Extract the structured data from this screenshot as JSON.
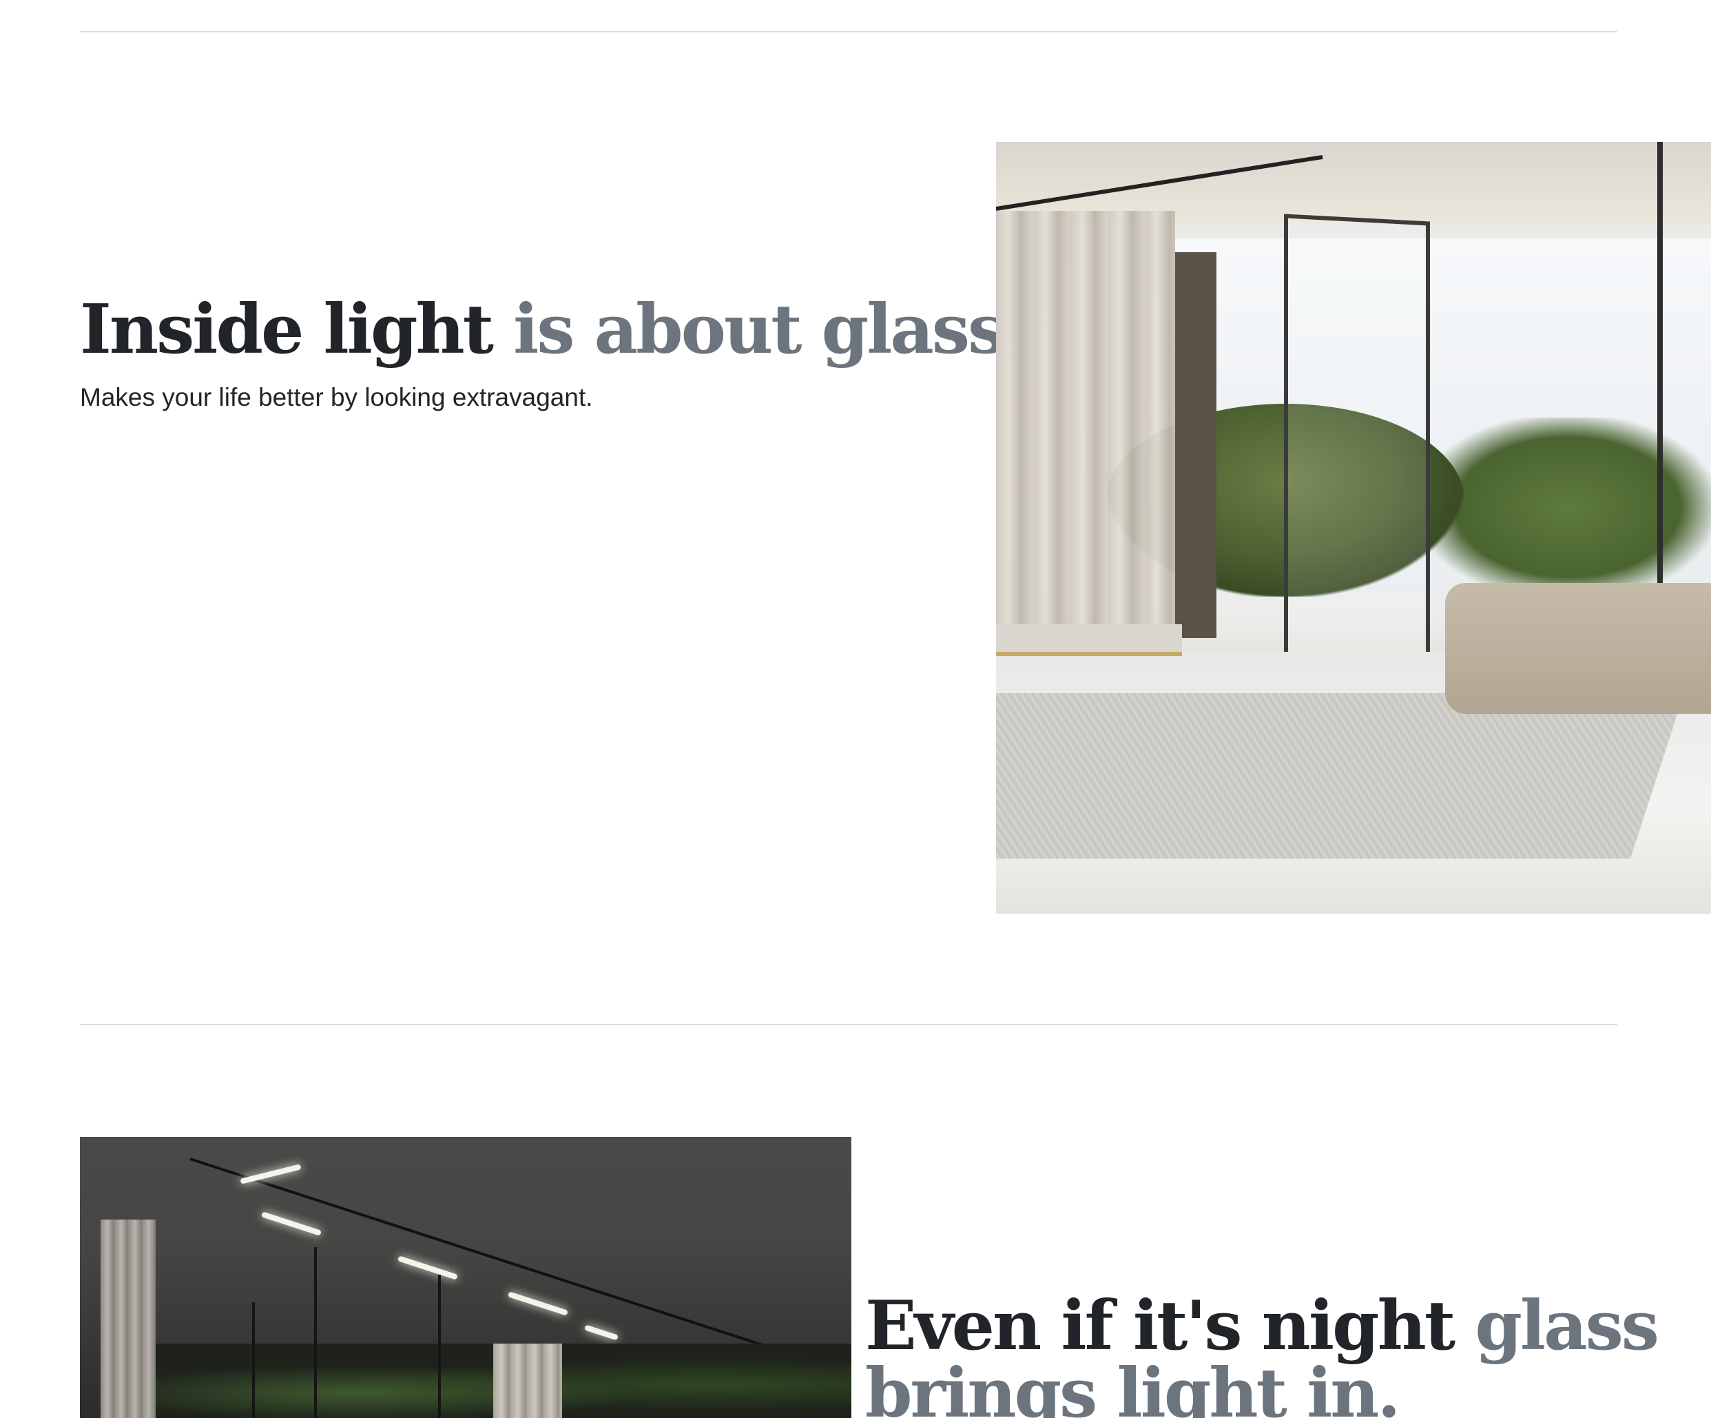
{
  "section1": {
    "heading_dark": "Inside light",
    "heading_muted": "is about glass.",
    "lead": "Makes your life better by looking extravagant."
  },
  "section2": {
    "heading_dark": "Even if it's night",
    "heading_muted": "glass brings light in."
  },
  "colors": {
    "text_dark": "#212529",
    "text_muted": "#6c757d",
    "divider": "#dcdcdc",
    "background": "#ffffff"
  }
}
